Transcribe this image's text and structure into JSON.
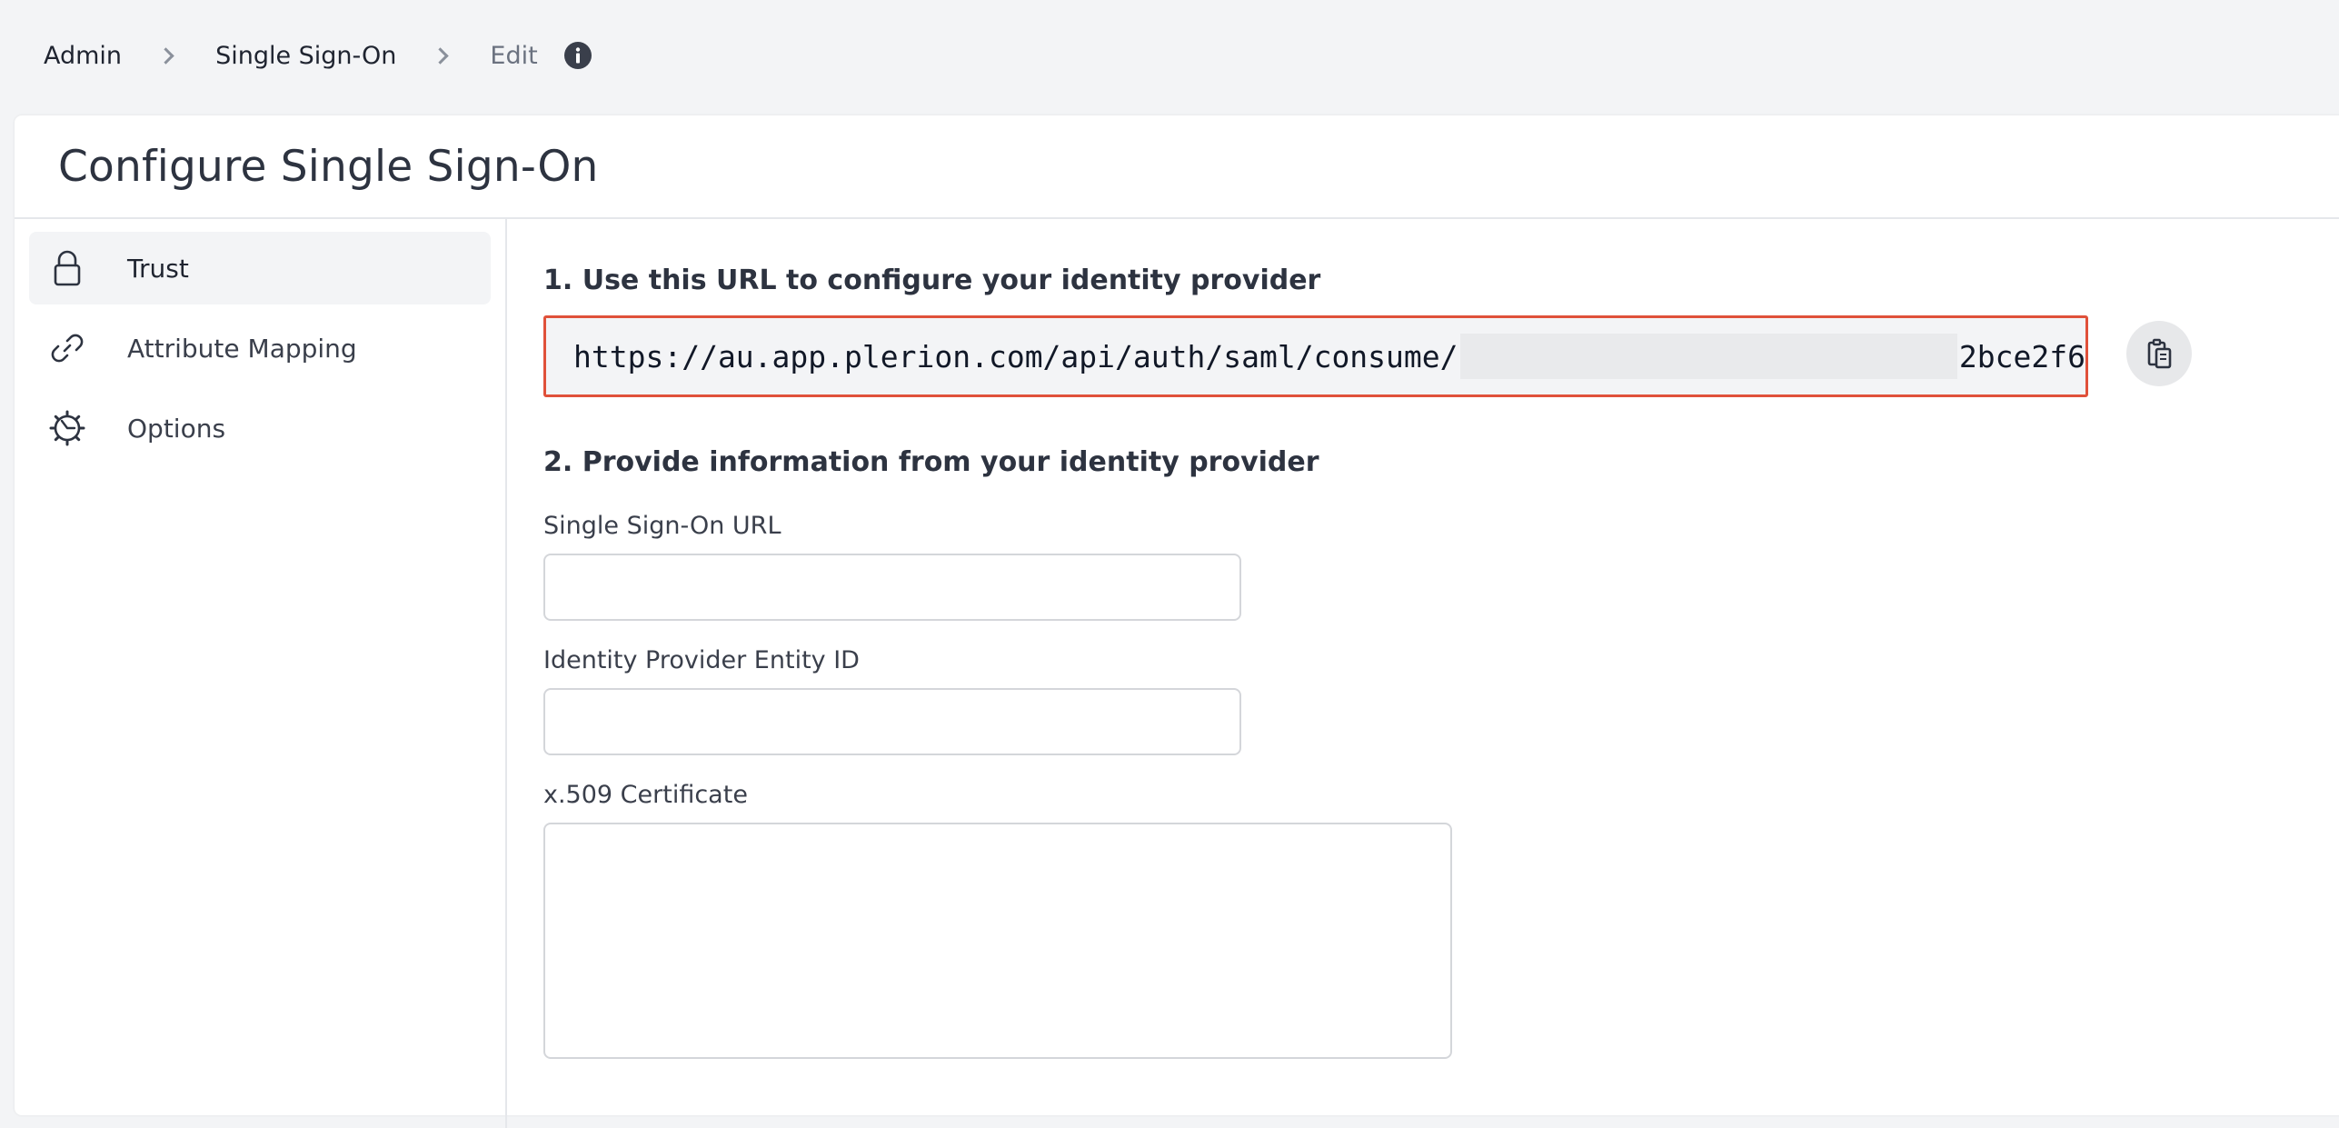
{
  "breadcrumb": {
    "items": [
      "Admin",
      "Single Sign-On",
      "Edit"
    ],
    "info_icon": "info-circle-icon"
  },
  "page": {
    "title": "Configure Single Sign-On"
  },
  "sidebar": {
    "items": [
      {
        "label": "Trust",
        "icon": "lock-icon",
        "active": true
      },
      {
        "label": "Attribute Mapping",
        "icon": "link-icon",
        "active": false
      },
      {
        "label": "Options",
        "icon": "gear-icon",
        "active": false
      }
    ]
  },
  "trust": {
    "step1_title": "1. Use this URL to configure your identity provider",
    "acs_url_prefix": "https://au.app.plerion.com/api/auth/saml/consume/",
    "acs_url_suffix": "2bce2f6",
    "copy_icon": "clipboard-copy-icon",
    "step2_title": "2. Provide information from your identity provider",
    "sso_url_label": "Single Sign-On URL",
    "sso_url_value": "",
    "entity_id_label": "Identity Provider Entity ID",
    "entity_id_value": "",
    "certificate_label": "x.509 Certificate",
    "certificate_value": ""
  },
  "colors": {
    "highlight_border": "#e0513a",
    "background": "#f3f4f6",
    "text": "#2d3340"
  }
}
